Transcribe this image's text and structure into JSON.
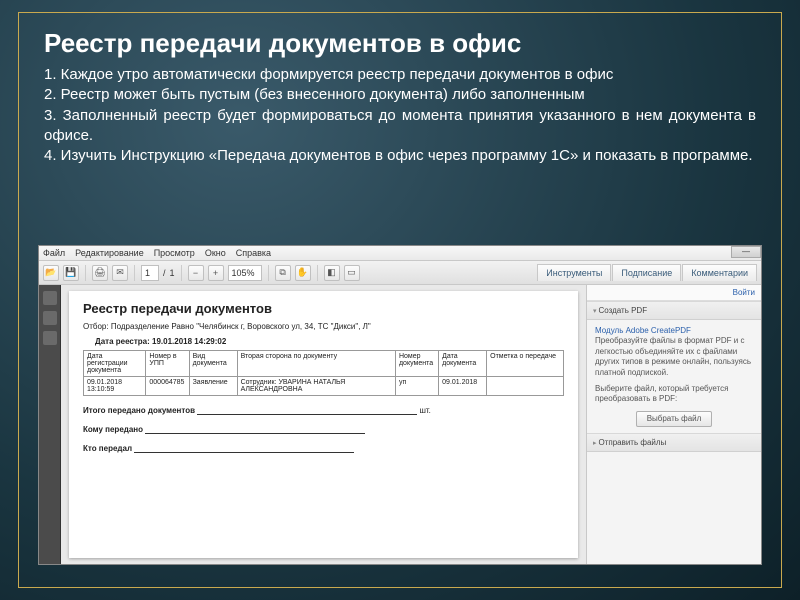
{
  "slide": {
    "title": "Реестр передачи документов в офис",
    "p1": "1. Каждое утро автоматически формируется реестр передачи документов в офис",
    "p2": "2. Реестр может быть пустым (без внесенного документа) либо заполненным",
    "p3": "3. Заполненный реестр будет формироваться до момента принятия указанного в нем документа в офисе.",
    "p4": "4. Изучить Инструкцию «Передача документов в офис через программу 1С» и показать в программе."
  },
  "menu": {
    "file": "Файл",
    "edit": "Редактирование",
    "view": "Просмотр",
    "window": "Окно",
    "help": "Справка"
  },
  "toolbar": {
    "page_cur": "1",
    "page_sep": "/",
    "page_total": "1",
    "zoom": "105%",
    "tab_tools": "Инструменты",
    "tab_sign": "Подписание",
    "tab_comment": "Комментарии"
  },
  "rightpanel": {
    "login": "Войти",
    "create_h": "Создать PDF",
    "create_mod": "Модуль Adobe CreatePDF",
    "create_desc": "Преобразуйте файлы в формат PDF и с легкостью объединяйте их с файлами других типов в режиме онлайн, пользуясь платной подпиской.",
    "select_label": "Выберите файл, который требуется преобразовать в PDF:",
    "select_btn": "Выбрать файл",
    "send_h": "Отправить файлы"
  },
  "document": {
    "title": "Реестр передачи документов",
    "filter_lbl": "Отбор:",
    "filter_val": "Подразделение Равно \"Челябинск г, Воровского ул, 34, ТС \"Дикси\", Л\"",
    "date_lbl": "Дата реестра:",
    "date_val": "19.01.2018 14:29:02",
    "headers": {
      "c1": "Дата регистрации документа",
      "c2": "Номер в УПП",
      "c3": "Вид документа",
      "c4": "Вторая сторона по документу",
      "c5": "Номер документа",
      "c6": "Дата документа",
      "c7": "Отметка о передаче"
    },
    "rows": [
      {
        "c1": "09.01.2018 13:10:59",
        "c2": "000064785",
        "c3": "Заявление",
        "c4": "Сотрудник: УВАРИНА НАТАЛЬЯ АЛЕКСАНДРОВНА",
        "c5": "уп",
        "c6": "09.01.2018",
        "c7": ""
      }
    ],
    "total_lbl": "Итого передано документов",
    "total_unit": "шт.",
    "to_whom": "Кому передано",
    "who": "Кто передал"
  }
}
